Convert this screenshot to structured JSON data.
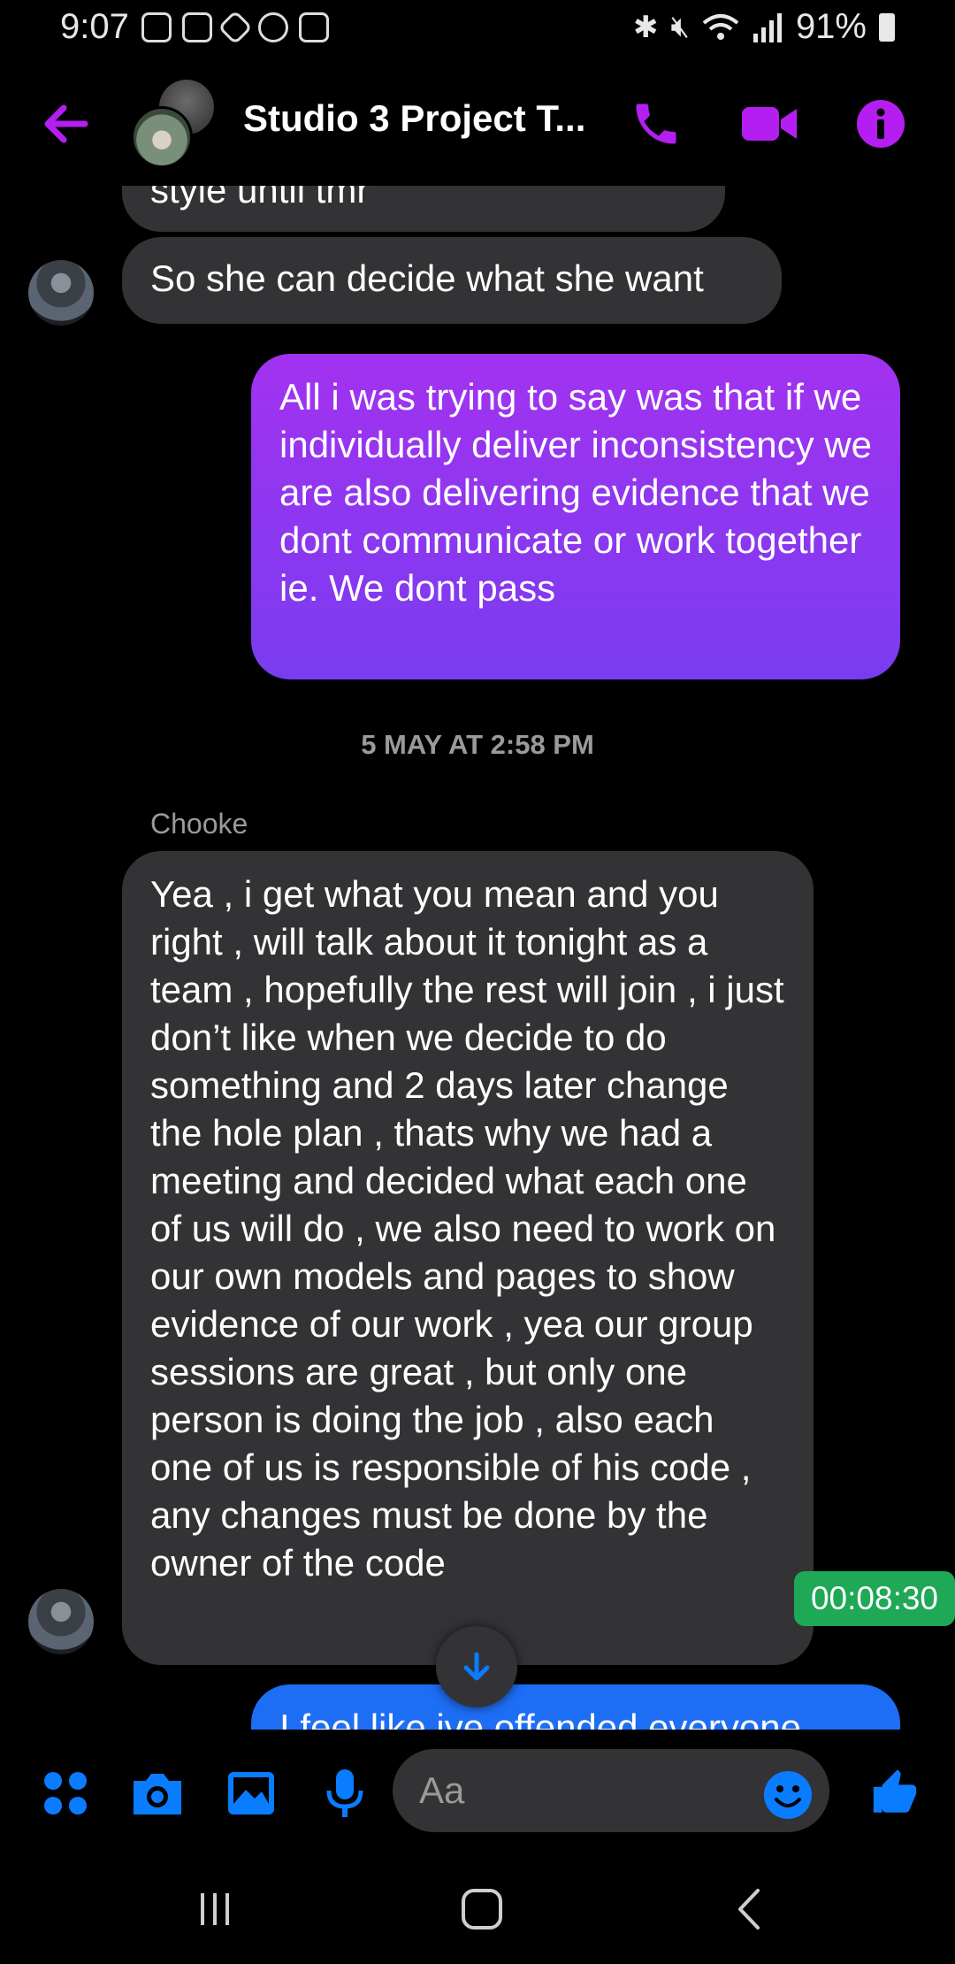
{
  "status_bar": {
    "time": "9:07",
    "battery": "91%",
    "icons": [
      "notification-icon",
      "notification-icon",
      "binance-icon",
      "messenger-icon",
      "notification-icon",
      "bluetooth-icon",
      "mute-icon",
      "wifi-icon",
      "signal-icon",
      "battery-icon"
    ]
  },
  "header": {
    "title": "Studio 3 Project T...",
    "accent_color": "#b51ef0"
  },
  "messages": {
    "partial_top": "style until tmr",
    "msg1": "So she can decide what she want",
    "msg2": "All i was trying to say was that if we individually deliver inconsistency we are also delivering evidence that we dont communicate or work together ie. We dont pass",
    "timestamp": "5 MAY AT 2:58 PM",
    "sender": "Chooke",
    "msg3": "Yea , i get what you mean and you right , will talk about it tonight as a team , hopefully the rest will join , i just don’t like when we decide to do something and 2 days later change the hole plan , thats why we had a meeting and decided what each one of us will do , we also need to work on our own models and pages to show evidence of our work , yea our group sessions are great , but only one person is doing the job , also each one of us is responsible of his code , any changes must be done by the owner of the code",
    "msg4_partial": "I feel like ive offended everyone"
  },
  "overlay": {
    "timer": "00:08:30"
  },
  "composer": {
    "placeholder": "Aa",
    "accent_color": "#0a7cff"
  }
}
